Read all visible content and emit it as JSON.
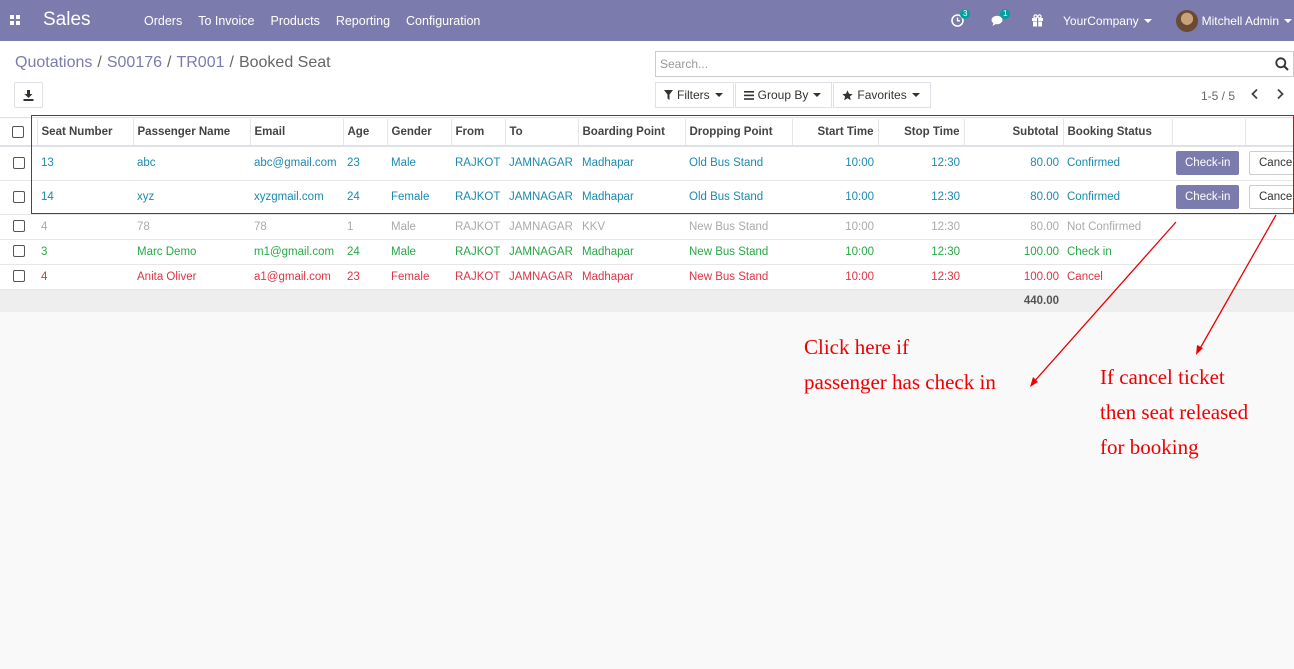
{
  "navbar": {
    "brand": "Sales",
    "menu": [
      "Orders",
      "To Invoice",
      "Products",
      "Reporting",
      "Configuration"
    ],
    "activity_badge": "3",
    "messages_badge": "1",
    "company": "YourCompany",
    "user": "Mitchell Admin",
    "accent_color": "#7c7bad"
  },
  "breadcrumb": {
    "items": [
      "Quotations",
      "S00176",
      "TR001"
    ],
    "current": "Booked Seat"
  },
  "search": {
    "placeholder": "Search..."
  },
  "filters": {
    "filters_label": "Filters",
    "groupby_label": "Group By",
    "favorites_label": "Favorites"
  },
  "pager": {
    "range": "1-5 / 5"
  },
  "table": {
    "columns": [
      "Seat Number",
      "Passenger Name",
      "Email",
      "Age",
      "Gender",
      "From",
      "To",
      "Boarding Point",
      "Dropping Point",
      "Start Time",
      "Stop Time",
      "Subtotal",
      "Booking Status"
    ],
    "rows": [
      {
        "seat": "13",
        "name": "abc",
        "email": "abc@gmail.com",
        "age": "23",
        "gender": "Male",
        "from": "RAJKOT",
        "to": "JAMNAGAR",
        "boarding": "Madhapar",
        "dropping": "Old Bus Stand",
        "start": "10:00",
        "stop": "12:30",
        "subtotal": "80.00",
        "status": "Confirmed",
        "checkin": "Check-in",
        "cancel": "Cancel"
      },
      {
        "seat": "14",
        "name": "xyz",
        "email": "xyzgmail.com",
        "age": "24",
        "gender": "Female",
        "from": "RAJKOT",
        "to": "JAMNAGAR",
        "boarding": "Madhapar",
        "dropping": "Old Bus Stand",
        "start": "10:00",
        "stop": "12:30",
        "subtotal": "80.00",
        "status": "Confirmed",
        "checkin": "Check-in",
        "cancel": "Cancel"
      },
      {
        "seat": "4",
        "name": "78",
        "email": "78",
        "age": "1",
        "gender": "Male",
        "from": "RAJKOT",
        "to": "JAMNAGAR",
        "boarding": "KKV",
        "dropping": "New Bus Stand",
        "start": "10:00",
        "stop": "12:30",
        "subtotal": "80.00",
        "status": "Not Confirmed"
      },
      {
        "seat": "3",
        "name": "Marc Demo",
        "email": "m1@gmail.com",
        "age": "24",
        "gender": "Male",
        "from": "RAJKOT",
        "to": "JAMNAGAR",
        "boarding": "Madhapar",
        "dropping": "New Bus Stand",
        "start": "10:00",
        "stop": "12:30",
        "subtotal": "100.00",
        "status": "Check in"
      },
      {
        "seat": "4",
        "name": "Anita Oliver",
        "email": "a1@gmail.com",
        "age": "23",
        "gender": "Female",
        "from": "RAJKOT",
        "to": "JAMNAGAR",
        "boarding": "Madhapar",
        "dropping": "New Bus Stand",
        "start": "10:00",
        "stop": "12:30",
        "subtotal": "100.00",
        "status": "Cancel"
      }
    ],
    "total": "440.00"
  },
  "annotations": {
    "checkin_line1": "Click here if",
    "checkin_line2": "passenger has check in",
    "cancel_line1": "If cancel ticket",
    "cancel_line2": "then seat released",
    "cancel_line3": "for booking",
    "color": "#e00000"
  }
}
